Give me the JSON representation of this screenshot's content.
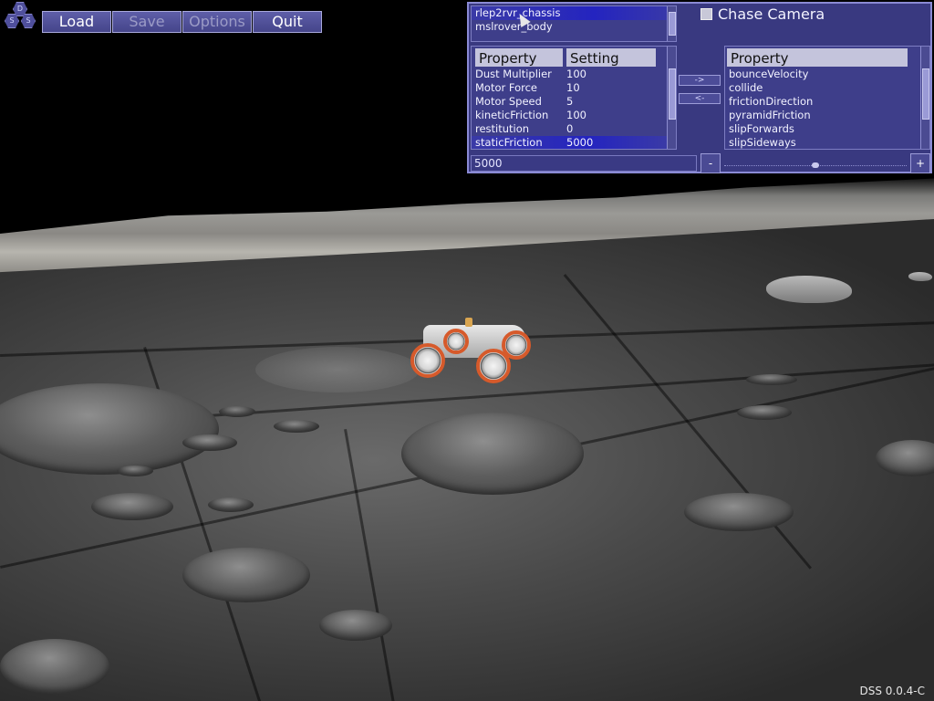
{
  "app": {
    "logo_letters": [
      "D",
      "S",
      "S"
    ],
    "version": "DSS 0.0.4-C"
  },
  "toolbar": {
    "load_label": "Load",
    "save_label": "Save",
    "options_label": "Options",
    "quit_label": "Quit",
    "save_enabled": false,
    "options_enabled": false
  },
  "panel": {
    "objects": [
      {
        "label": "rlep2rvr_chassis",
        "selected": true
      },
      {
        "label": "mslrover_body",
        "selected": false
      }
    ],
    "chase_camera_label": "Chase Camera",
    "chase_camera_checked": false,
    "left_table": {
      "headers": [
        "Property",
        "Setting"
      ],
      "rows": [
        {
          "property": "Dust Multiplier",
          "setting": "100",
          "selected": false
        },
        {
          "property": "Motor Force",
          "setting": "10",
          "selected": false
        },
        {
          "property": "Motor Speed",
          "setting": "5",
          "selected": false
        },
        {
          "property": "kineticFriction",
          "setting": "100",
          "selected": false
        },
        {
          "property": "restitution",
          "setting": "0",
          "selected": false
        },
        {
          "property": "staticFriction",
          "setting": "5000",
          "selected": true
        }
      ]
    },
    "move_right_label": "->",
    "move_left_label": "<-",
    "right_table": {
      "header": "Property",
      "rows": [
        "bounceVelocity",
        "collide",
        "frictionDirection",
        "pyramidFriction",
        "slipForwards",
        "slipSideways"
      ]
    },
    "value_field": "5000",
    "minus_label": "-",
    "plus_label": "+",
    "slider_level": 0.5
  },
  "colors": {
    "panel_bg": "#393980",
    "button_bg": "#4f4f9c",
    "wheel_accent": "#d65a2b"
  },
  "icons": {
    "cursor": "mouse-pointer-icon"
  }
}
